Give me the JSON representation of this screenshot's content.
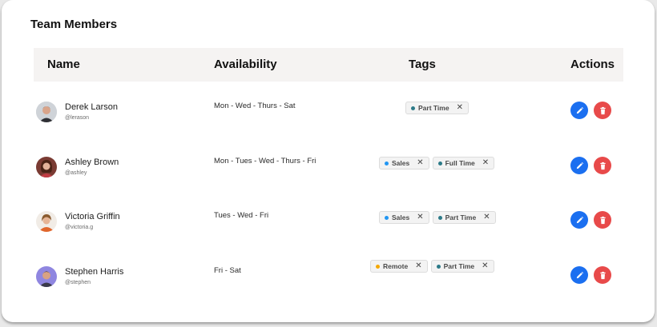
{
  "title": "Team Members",
  "columns": {
    "name": "Name",
    "availability": "Availability",
    "tags": "Tags",
    "actions": "Actions"
  },
  "colors": {
    "edit_button": "#1b6ff0",
    "delete_button": "#e84a4a",
    "tag_part_time": "#2c7a88",
    "tag_full_time": "#2c7a88",
    "tag_sales": "#2196f3",
    "tag_remote": "#f5a800"
  },
  "members": [
    {
      "name": "Derek Larson",
      "handle": "@lerason",
      "availability": "Mon - Wed - Thurs - Sat",
      "tags": [
        {
          "label": "Part Time",
          "color": "#2c7a88"
        }
      ]
    },
    {
      "name": "Ashley Brown",
      "handle": "@ashley",
      "availability": "Mon - Tues - Wed - Thurs - Fri",
      "tags": [
        {
          "label": "Sales",
          "color": "#2196f3"
        },
        {
          "label": "Full Time",
          "color": "#2c7a88"
        }
      ]
    },
    {
      "name": "Victoria Griffin",
      "handle": "@victoria.g",
      "availability": "Tues - Wed - Fri",
      "tags": [
        {
          "label": "Sales",
          "color": "#2196f3"
        },
        {
          "label": "Part Time",
          "color": "#2c7a88"
        }
      ]
    },
    {
      "name": "Stephen Harris",
      "handle": "@stephen",
      "availability": "Fri - Sat",
      "tags": [
        {
          "label": "Remote",
          "color": "#f5a800"
        },
        {
          "label": "Part Time",
          "color": "#2c7a88"
        }
      ]
    }
  ],
  "tag_remove_glyph": "✕"
}
